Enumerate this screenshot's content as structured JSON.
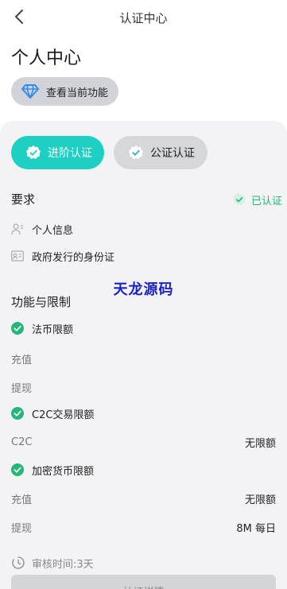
{
  "nav": {
    "title": "认证中心"
  },
  "page": {
    "title": "个人中心"
  },
  "feature_button": {
    "label": "查看当前功能",
    "icon": "diamond-icon",
    "icon_color": "#2d8cf0"
  },
  "tabs": [
    {
      "label": "进阶认证",
      "active": true
    },
    {
      "label": "公证认证",
      "active": false
    }
  ],
  "requirements": {
    "title": "要求",
    "status": "已认证",
    "items": [
      {
        "icon": "user-info-icon",
        "label": "个人信息"
      },
      {
        "icon": "id-card-icon",
        "label": "政府发行的身份证"
      }
    ]
  },
  "watermark": "天龙源码",
  "features": {
    "title": "功能与限制",
    "groups": [
      {
        "title": "法币限额",
        "rows": [
          {
            "key": "充值",
            "value": ""
          },
          {
            "key": "提现",
            "value": ""
          }
        ]
      },
      {
        "title": "C2C交易限额",
        "rows": [
          {
            "key": "C2C",
            "value": "无限额"
          }
        ]
      },
      {
        "title": "加密货币限额",
        "rows": [
          {
            "key": "充值",
            "value": "无限额"
          },
          {
            "key": "提现",
            "value": "8M 每日"
          }
        ]
      }
    ]
  },
  "review": {
    "label": "审核时间:3天"
  },
  "bottom_button": {
    "label": "认证详情"
  },
  "colors": {
    "accent": "#1ecfc3",
    "success": "#26b57a",
    "watermark": "#1b22c4",
    "panel": "#f3f3f5"
  }
}
